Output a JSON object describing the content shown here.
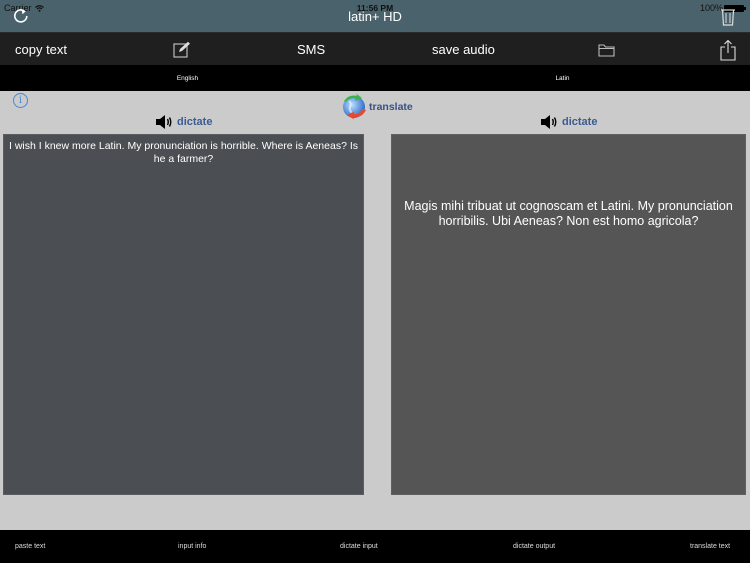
{
  "status_bar": {
    "carrier": "Carrier",
    "time": "11:56 PM",
    "battery": "100%"
  },
  "nav": {
    "title": "latin+ HD",
    "left_icon": "refresh-icon",
    "right_icon": "trash-icon"
  },
  "toolbar": {
    "copy_label": "copy text",
    "compose_icon": "compose-icon",
    "sms_label": "SMS",
    "save_audio_label": "save audio",
    "folder_icon": "folder-icon",
    "share_icon": "share-icon"
  },
  "languages": {
    "source": "English",
    "target": "Latin"
  },
  "main": {
    "info_icon": "info-icon",
    "translate_label": "translate",
    "dictate_left_label": "dictate",
    "dictate_right_label": "dictate",
    "input_text": "I wish I knew more Latin. My pronunciation is horrible. Where is Aeneas? Is he a farmer?",
    "output_text": "Magis mihi tribuat ut cognoscam et Latini. My pronunciation horribilis. Ubi Aeneas? Non est homo agricola?"
  },
  "bottom_bar": {
    "items": [
      "paste text",
      "input info",
      "dictate input",
      "dictate output",
      "translate text"
    ]
  },
  "colors": {
    "nav_bg": "#4a626b",
    "toolbar_bg": "#1f1f1f",
    "content_bg": "#cbcbcb",
    "input_panel_bg": "#4b4f53",
    "output_panel_bg": "#555555",
    "link_blue": "#3c5c91"
  }
}
